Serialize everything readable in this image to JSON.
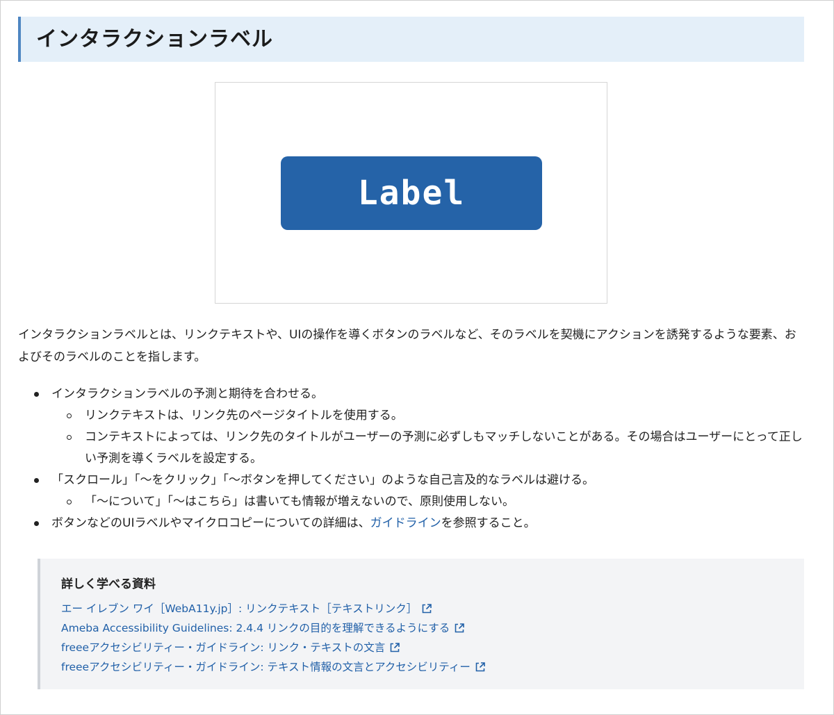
{
  "section": {
    "title": "インタラクションラベル"
  },
  "figure": {
    "button_label": "Label",
    "button_color": "#2563a8"
  },
  "intro": "インタラクションラベルとは、リンクテキストや、UIの操作を導くボタンのラベルなど、そのラベルを契機にアクションを誘発するような要素、およびそのラベルのことを指します。",
  "bullets": [
    {
      "text": "インタラクションラベルの予測と期待を合わせる。",
      "children": [
        "リンクテキストは、リンク先のページタイトルを使用する。",
        "コンテキストによっては、リンク先のタイトルがユーザーの予測に必ずしもマッチしないことがある。その場合はユーザーにとって正しい予測を導くラベルを設定する。"
      ]
    },
    {
      "text": "「スクロール」「〜をクリック」「〜ボタンを押してください」のような自己言及的なラベルは避ける。",
      "children": [
        "「〜について」「〜はこちら」は書いても情報が増えないので、原則使用しない。"
      ]
    },
    {
      "text_before": "ボタンなどのUIラベルやマイクロコピーについての詳細は、",
      "link": "ガイドライン",
      "text_after": "を参照すること。"
    }
  ],
  "resources": {
    "title": "詳しく学べる資料",
    "links": [
      "エー イレブン ワイ［WebA11y.jp］: リンクテキスト［テキストリンク］",
      "Ameba Accessibility Guidelines: 2.4.4 リンクの目的を理解できるようにする",
      "freeeアクセシビリティー・ガイドライン: リンク・テキストの文言",
      "freeeアクセシビリティー・ガイドライン: テキスト情報の文言とアクセシビリティー"
    ],
    "link_icon": "external-link-icon",
    "link_color": "#2160a8"
  }
}
